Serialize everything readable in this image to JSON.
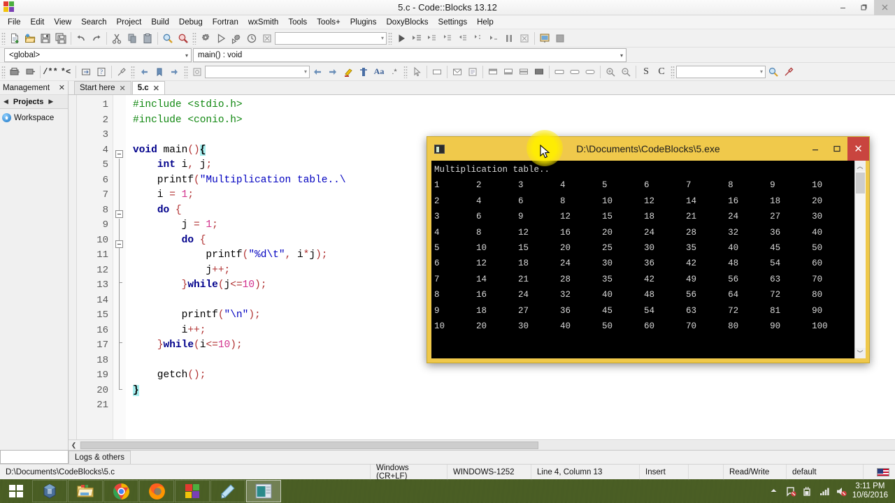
{
  "window": {
    "title": "5.c - Code::Blocks 13.12",
    "logo_icon": "codeblocks-logo-icon",
    "minimize_label": "Minimize",
    "maximize_label": "Restore",
    "close_label": "Close"
  },
  "menubar": {
    "items": [
      {
        "label": "File"
      },
      {
        "label": "Edit"
      },
      {
        "label": "View"
      },
      {
        "label": "Search"
      },
      {
        "label": "Project"
      },
      {
        "label": "Build"
      },
      {
        "label": "Debug"
      },
      {
        "label": "Fortran"
      },
      {
        "label": "wxSmith"
      },
      {
        "label": "Tools"
      },
      {
        "label": "Tools+"
      },
      {
        "label": "Plugins"
      },
      {
        "label": "DoxyBlocks"
      },
      {
        "label": "Settings"
      },
      {
        "label": "Help"
      }
    ]
  },
  "toolbar_main": {
    "icons": [
      "new-file-icon",
      "open-file-icon",
      "save-icon",
      "save-all-icon",
      "undo-icon",
      "redo-icon",
      "cut-icon",
      "copy-icon",
      "paste-icon",
      "find-icon",
      "replace-icon"
    ]
  },
  "toolbar_build": {
    "icons": [
      "build-icon",
      "run-icon",
      "build-and-run-icon",
      "rebuild-icon",
      "abort-icon"
    ],
    "target_combo_value": "",
    "target_combo_placeholder": ""
  },
  "toolbar_debug": {
    "icons": [
      "debug-continue-icon",
      "debug-run-to-cursor-icon",
      "debug-next-line-icon",
      "debug-step-into-icon",
      "debug-step-out-icon",
      "debug-next-instruction-icon",
      "debug-step-instruction-icon",
      "debug-break-icon",
      "debug-stop-icon",
      "debugging-windows-icon",
      "various-info-icon"
    ]
  },
  "toolbar_doxyblocks": {
    "icons": [
      "doxyblocks-extract-icon",
      "doxyblocks-comment-icon",
      "doxyblocks-block-comment-icon",
      "doxyblocks-line-comment-icon",
      "doxyblocks-wizard-icon",
      "back-icon",
      "forward-icon",
      "highlight-icon",
      "insert-icon",
      "abbrev-icon",
      "more-icon"
    ],
    "search_combo_value": ""
  },
  "toolbar_wxsmith": {
    "icons": [
      "pointer-icon",
      "panel-icon",
      "dialog-icon",
      "frame-icon",
      "layout-top-icon",
      "layout-bottom-icon",
      "layout-center-icon",
      "layout-fill-icon",
      "box-sizer-icon",
      "grid-sizer-icon",
      "flex-sizer-icon",
      "zoom-in-icon",
      "zoom-out-icon",
      "select-source-icon",
      "select-class-icon"
    ],
    "search_combo_value": "",
    "trailing_icons": [
      "search-icon",
      "tools-icon"
    ]
  },
  "scope": {
    "namespace": "<global>",
    "function": "main() : void"
  },
  "management": {
    "title": "Management",
    "close_icon": "close-icon",
    "prev_icon": "chevron-left-icon",
    "next_icon": "chevron-right-icon",
    "active_tab": "Projects",
    "tree": [
      {
        "label": "Workspace",
        "icon": "workspace-icon"
      }
    ]
  },
  "editor": {
    "tabs": [
      {
        "label": "Start here",
        "active": false,
        "close_icon": "close-icon"
      },
      {
        "label": "5.c",
        "active": true,
        "close_icon": "close-icon"
      }
    ],
    "line_numbers": [
      1,
      2,
      3,
      4,
      5,
      6,
      7,
      8,
      9,
      10,
      11,
      12,
      13,
      14,
      15,
      16,
      17,
      18,
      19,
      20,
      21
    ],
    "code_lines": [
      {
        "n": 1,
        "tokens": [
          {
            "t": "#include <stdio.h>",
            "c": "k-pre"
          }
        ]
      },
      {
        "n": 2,
        "tokens": [
          {
            "t": "#include <conio.h>",
            "c": "k-pre"
          }
        ]
      },
      {
        "n": 3,
        "tokens": []
      },
      {
        "n": 4,
        "tokens": [
          {
            "t": "void",
            "c": "k-key"
          },
          {
            "t": " main",
            "c": "k-plain"
          },
          {
            "t": "()",
            "c": "k-op"
          },
          {
            "t": "{",
            "c": "k-hl"
          }
        ]
      },
      {
        "n": 5,
        "tokens": [
          {
            "t": "    ",
            "c": "k-plain"
          },
          {
            "t": "int",
            "c": "k-key"
          },
          {
            "t": " i",
            "c": "k-plain"
          },
          {
            "t": ",",
            "c": "k-op"
          },
          {
            "t": " j",
            "c": "k-plain"
          },
          {
            "t": ";",
            "c": "k-op"
          }
        ]
      },
      {
        "n": 6,
        "tokens": [
          {
            "t": "    printf",
            "c": "k-plain"
          },
          {
            "t": "(",
            "c": "k-op"
          },
          {
            "t": "\"Multiplication table..\\",
            "c": "k-str"
          }
        ]
      },
      {
        "n": 7,
        "tokens": [
          {
            "t": "    i ",
            "c": "k-plain"
          },
          {
            "t": "=",
            "c": "k-op"
          },
          {
            "t": " ",
            "c": "k-plain"
          },
          {
            "t": "1",
            "c": "k-num"
          },
          {
            "t": ";",
            "c": "k-op"
          }
        ]
      },
      {
        "n": 8,
        "tokens": [
          {
            "t": "    ",
            "c": "k-plain"
          },
          {
            "t": "do",
            "c": "k-key"
          },
          {
            "t": " ",
            "c": "k-plain"
          },
          {
            "t": "{",
            "c": "k-op"
          }
        ]
      },
      {
        "n": 9,
        "tokens": [
          {
            "t": "        j ",
            "c": "k-plain"
          },
          {
            "t": "=",
            "c": "k-op"
          },
          {
            "t": " ",
            "c": "k-plain"
          },
          {
            "t": "1",
            "c": "k-num"
          },
          {
            "t": ";",
            "c": "k-op"
          }
        ]
      },
      {
        "n": 10,
        "tokens": [
          {
            "t": "        ",
            "c": "k-plain"
          },
          {
            "t": "do",
            "c": "k-key"
          },
          {
            "t": " ",
            "c": "k-plain"
          },
          {
            "t": "{",
            "c": "k-op"
          }
        ]
      },
      {
        "n": 11,
        "tokens": [
          {
            "t": "            printf",
            "c": "k-plain"
          },
          {
            "t": "(",
            "c": "k-op"
          },
          {
            "t": "\"%d\\t\"",
            "c": "k-str"
          },
          {
            "t": ",",
            "c": "k-op"
          },
          {
            "t": " i",
            "c": "k-plain"
          },
          {
            "t": "*",
            "c": "k-op"
          },
          {
            "t": "j",
            "c": "k-plain"
          },
          {
            "t": ");",
            "c": "k-op"
          }
        ]
      },
      {
        "n": 12,
        "tokens": [
          {
            "t": "            j",
            "c": "k-plain"
          },
          {
            "t": "++;",
            "c": "k-op"
          }
        ]
      },
      {
        "n": 13,
        "tokens": [
          {
            "t": "        ",
            "c": "k-plain"
          },
          {
            "t": "}",
            "c": "k-op"
          },
          {
            "t": "while",
            "c": "k-key"
          },
          {
            "t": "(",
            "c": "k-op"
          },
          {
            "t": "j",
            "c": "k-plain"
          },
          {
            "t": "<=",
            "c": "k-op"
          },
          {
            "t": "10",
            "c": "k-num"
          },
          {
            "t": ");",
            "c": "k-op"
          }
        ]
      },
      {
        "n": 14,
        "tokens": []
      },
      {
        "n": 15,
        "tokens": [
          {
            "t": "        printf",
            "c": "k-plain"
          },
          {
            "t": "(",
            "c": "k-op"
          },
          {
            "t": "\"\\n\"",
            "c": "k-str"
          },
          {
            "t": ");",
            "c": "k-op"
          }
        ]
      },
      {
        "n": 16,
        "tokens": [
          {
            "t": "        i",
            "c": "k-plain"
          },
          {
            "t": "++;",
            "c": "k-op"
          }
        ]
      },
      {
        "n": 17,
        "tokens": [
          {
            "t": "    ",
            "c": "k-plain"
          },
          {
            "t": "}",
            "c": "k-op"
          },
          {
            "t": "while",
            "c": "k-key"
          },
          {
            "t": "(",
            "c": "k-op"
          },
          {
            "t": "i",
            "c": "k-plain"
          },
          {
            "t": "<=",
            "c": "k-op"
          },
          {
            "t": "10",
            "c": "k-num"
          },
          {
            "t": ");",
            "c": "k-op"
          }
        ]
      },
      {
        "n": 18,
        "tokens": []
      },
      {
        "n": 19,
        "tokens": [
          {
            "t": "    getch",
            "c": "k-plain"
          },
          {
            "t": "();",
            "c": "k-op"
          }
        ]
      },
      {
        "n": 20,
        "tokens": [
          {
            "t": "}",
            "c": "k-hl"
          }
        ]
      },
      {
        "n": 21,
        "tokens": []
      }
    ]
  },
  "logs_pane": {
    "tab_label": "Logs & others"
  },
  "statusbar": {
    "file_path": "D:\\Documents\\CodeBlocks\\5.c",
    "line_ending": "Windows (CR+LF)",
    "encoding": "WINDOWS-1252",
    "caret": "Line 4, Column 13",
    "insert_mode": "Insert",
    "blank": "",
    "permission": "Read/Write",
    "profile": "default",
    "keyboard_icon": "us-flag-icon"
  },
  "console_window": {
    "title": "D:\\Documents\\CodeBlocks\\5.exe",
    "icon": "console-icon",
    "minimize_label": "Minimize",
    "maximize_label": "Maximize",
    "close_label": "Close",
    "header_line": "Multiplication table..",
    "scroll_up_icon": "chevron-up-icon",
    "scroll_down_icon": "chevron-down-icon",
    "titlebar_color": "#f0c94b",
    "background_color": "#000000",
    "text_color": "#d8d8d8"
  },
  "console_table": {
    "type": "table",
    "title": "Multiplication table..",
    "rows": [
      [
        1,
        2,
        3,
        4,
        5,
        6,
        7,
        8,
        9,
        10
      ],
      [
        2,
        4,
        6,
        8,
        10,
        12,
        14,
        16,
        18,
        20
      ],
      [
        3,
        6,
        9,
        12,
        15,
        18,
        21,
        24,
        27,
        30
      ],
      [
        4,
        8,
        12,
        16,
        20,
        24,
        28,
        32,
        36,
        40
      ],
      [
        5,
        10,
        15,
        20,
        25,
        30,
        35,
        40,
        45,
        50
      ],
      [
        6,
        12,
        18,
        24,
        30,
        36,
        42,
        48,
        54,
        60
      ],
      [
        7,
        14,
        21,
        28,
        35,
        42,
        49,
        56,
        63,
        70
      ],
      [
        8,
        16,
        24,
        32,
        40,
        48,
        56,
        64,
        72,
        80
      ],
      [
        9,
        18,
        27,
        36,
        45,
        54,
        63,
        72,
        81,
        90
      ],
      [
        10,
        20,
        30,
        40,
        50,
        60,
        70,
        80,
        90,
        100
      ]
    ]
  },
  "cursor": {
    "glow_color": "#ffee00",
    "pointer_icon": "mouse-pointer-icon"
  },
  "taskbar": {
    "start_icon": "windows-start-icon",
    "items": [
      {
        "name": "virtualbox-icon",
        "active": false
      },
      {
        "name": "file-explorer-icon",
        "active": false
      },
      {
        "name": "google-chrome-icon",
        "active": false
      },
      {
        "name": "firefox-icon",
        "active": false
      },
      {
        "name": "codeblocks-icon",
        "active": false
      },
      {
        "name": "paint-icon",
        "active": false
      },
      {
        "name": "console-window-icon",
        "active": true
      }
    ],
    "tray": [
      {
        "name": "show-hidden-icons-icon"
      },
      {
        "name": "action-center-icon"
      },
      {
        "name": "battery-icon"
      },
      {
        "name": "network-icon"
      },
      {
        "name": "volume-muted-icon"
      }
    ],
    "clock_time": "3:11 PM",
    "clock_date": "10/6/2016"
  }
}
